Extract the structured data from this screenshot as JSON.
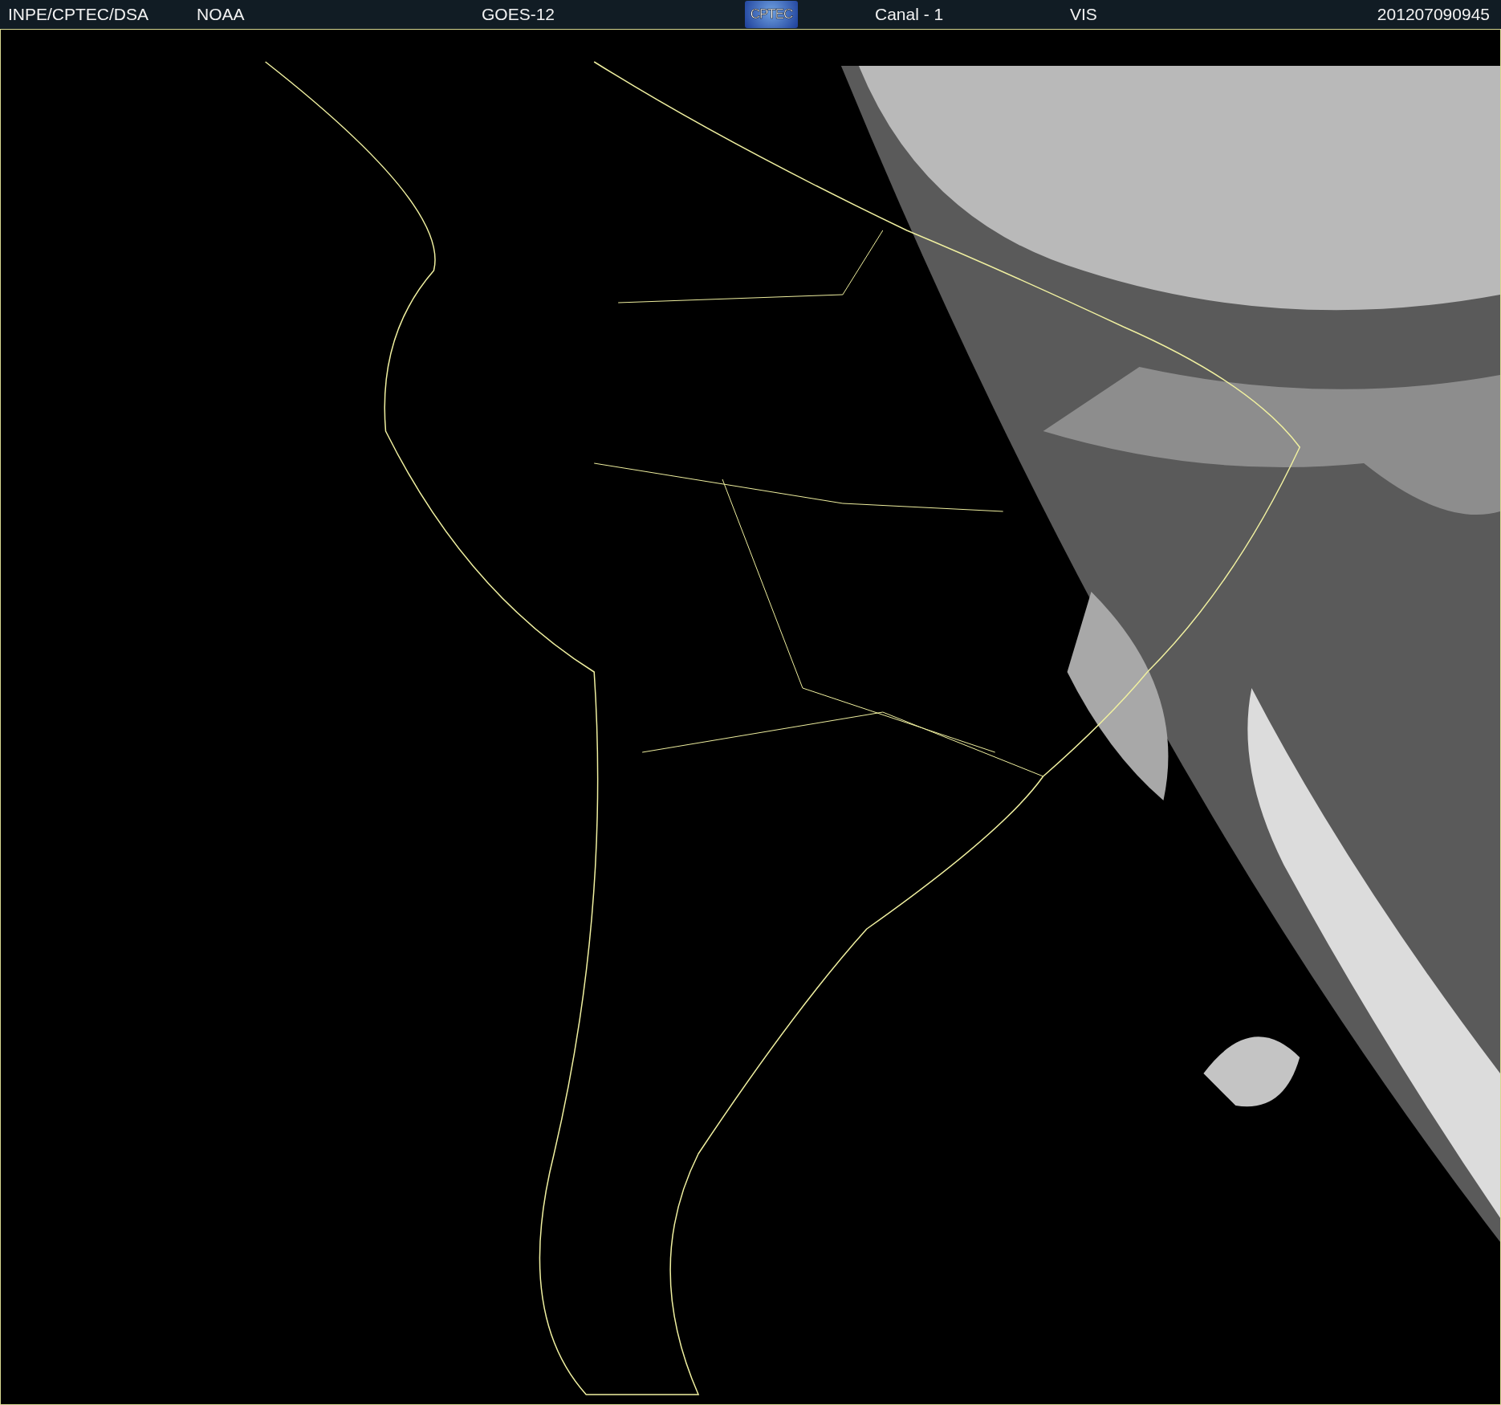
{
  "header": {
    "items": [
      {
        "kind": "text",
        "text": "INPE/CPTEC/DSA"
      },
      {
        "kind": "text",
        "text": "NOAA"
      },
      {
        "kind": "text",
        "text": "GOES-12"
      },
      {
        "kind": "logo",
        "text": "CPTEC"
      },
      {
        "kind": "text",
        "text": "Canal - 1"
      },
      {
        "kind": "text",
        "text": "VIS"
      },
      {
        "kind": "text",
        "text": "201207090945"
      }
    ]
  }
}
